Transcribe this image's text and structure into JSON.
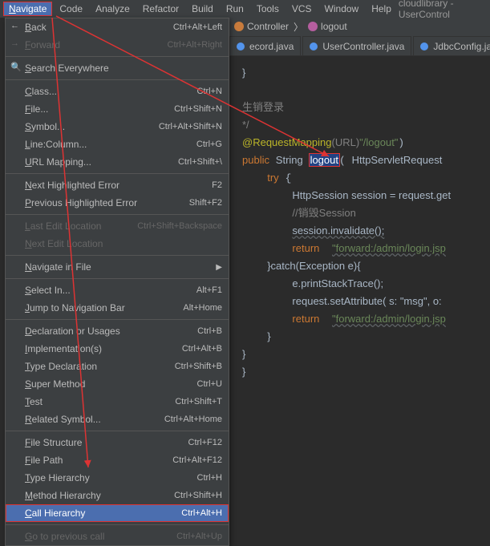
{
  "menubar": {
    "items": {
      "navigate": "Navigate",
      "code": "Code",
      "analyze": "Analyze",
      "refactor": "Refactor",
      "build": "Build",
      "run": "Run",
      "tools": "Tools",
      "vcs": "VCS",
      "window": "Window",
      "help": "Help"
    },
    "title": "cloudlibrary - UserControl"
  },
  "dropdown": [
    {
      "label": "Back",
      "pre": "←",
      "sc": "Ctrl+Alt+Left"
    },
    {
      "label": "Forward",
      "pre": "→",
      "sc": "Ctrl+Alt+Right",
      "dis": true
    },
    {
      "sep": true
    },
    {
      "label": "Search Everywhere",
      "pre": "🔍"
    },
    {
      "sep": true
    },
    {
      "label": "Class...",
      "sc": "Ctrl+N"
    },
    {
      "label": "File...",
      "sc": "Ctrl+Shift+N"
    },
    {
      "label": "Symbol...",
      "sc": "Ctrl+Alt+Shift+N"
    },
    {
      "label": "Line:Column...",
      "sc": "Ctrl+G"
    },
    {
      "label": "URL Mapping...",
      "sc": "Ctrl+Shift+\\"
    },
    {
      "sep": true
    },
    {
      "label": "Next Highlighted Error",
      "sc": "F2"
    },
    {
      "label": "Previous Highlighted Error",
      "sc": "Shift+F2"
    },
    {
      "sep": true
    },
    {
      "label": "Last Edit Location",
      "sc": "Ctrl+Shift+Backspace",
      "dis": true
    },
    {
      "label": "Next Edit Location",
      "dis": true
    },
    {
      "sep": true
    },
    {
      "label": "Navigate in File",
      "arrow": true
    },
    {
      "sep": true
    },
    {
      "label": "Select In...",
      "sc": "Alt+F1"
    },
    {
      "label": "Jump to Navigation Bar",
      "sc": "Alt+Home"
    },
    {
      "sep": true
    },
    {
      "label": "Declaration or Usages",
      "sc": "Ctrl+B"
    },
    {
      "label": "Implementation(s)",
      "sc": "Ctrl+Alt+B"
    },
    {
      "label": "Type Declaration",
      "sc": "Ctrl+Shift+B"
    },
    {
      "label": "Super Method",
      "sc": "Ctrl+U"
    },
    {
      "label": "Test",
      "sc": "Ctrl+Shift+T"
    },
    {
      "label": "Related Symbol...",
      "sc": "Ctrl+Alt+Home"
    },
    {
      "sep": true
    },
    {
      "label": "File Structure",
      "sc": "Ctrl+F12"
    },
    {
      "label": "File Path",
      "sc": "Ctrl+Alt+F12"
    },
    {
      "label": "Type Hierarchy",
      "sc": "Ctrl+H"
    },
    {
      "label": "Method Hierarchy",
      "sc": "Ctrl+Shift+H"
    },
    {
      "label": "Call Hierarchy",
      "sc": "Ctrl+Alt+H",
      "hl": true,
      "box": true
    },
    {
      "sep": true
    },
    {
      "label": "Go to previous call",
      "sc": "Ctrl+Alt+Up",
      "dis": true
    }
  ],
  "breadcrumb": {
    "controller": "Controller",
    "method": "logout"
  },
  "tabs": [
    {
      "label": "ecord.java"
    },
    {
      "label": "UserController.java"
    },
    {
      "label": "JdbcConfig.jav"
    }
  ],
  "code": {
    "l1": "}",
    "c1": "生销登录",
    "c2": "*/",
    "ann": "@RequestMapping",
    "annIconAlt": "(URL)",
    "str1": "\"/logout\"",
    "kw_public": "public",
    "t_string": "String",
    "fn": "logout",
    "param": "HttpServletRequest",
    "kw_try": "try",
    "l_sess": "HttpSession session = request.get",
    "c3": "//销毁Session",
    "l_inv": "session.invalidate();",
    "kw_return": "return",
    "str2": "\"forward:/admin/login.jsp",
    "l_catch": "}catch(Exception e){",
    "l_trace": "e.printStackTrace();",
    "l_setattr": "request.setAttribute( s: \"msg\", o:",
    "str3": "\"forward:/admin/login.jsp",
    "brace": "}"
  }
}
